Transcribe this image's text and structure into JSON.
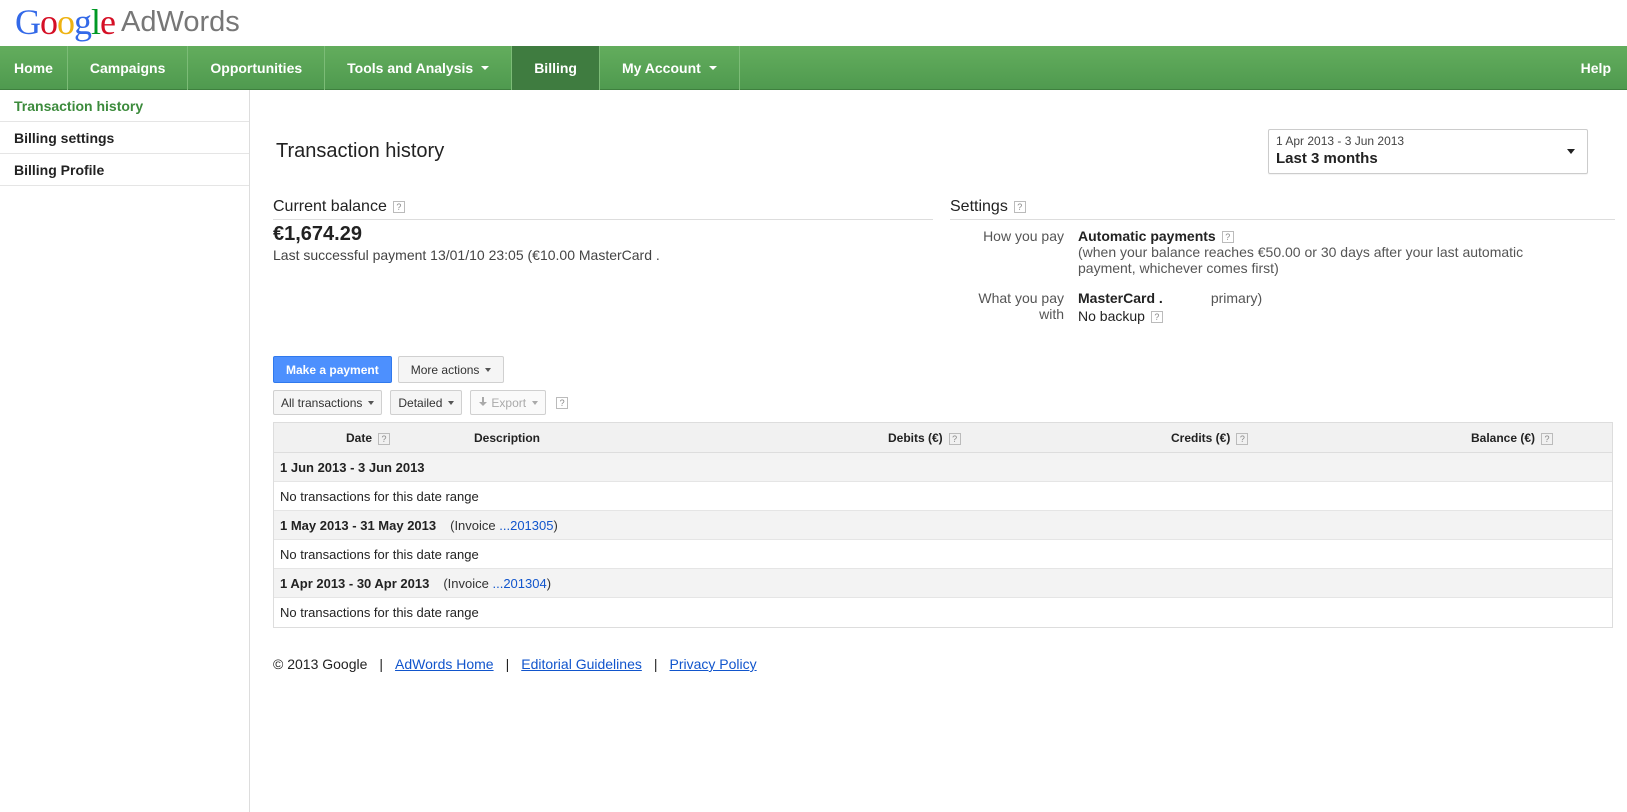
{
  "brand": {
    "google": "Google",
    "product": "AdWords"
  },
  "nav": {
    "tabs": [
      {
        "label": "Home"
      },
      {
        "label": "Campaigns"
      },
      {
        "label": "Opportunities"
      },
      {
        "label": "Tools and Analysis"
      },
      {
        "label": "Billing"
      },
      {
        "label": "My Account"
      }
    ],
    "help": "Help",
    "active": "Billing"
  },
  "sidebar": {
    "items": [
      {
        "label": "Transaction history"
      },
      {
        "label": "Billing settings"
      },
      {
        "label": "Billing Profile"
      }
    ]
  },
  "page": {
    "title": "Transaction history",
    "date_range": {
      "range": "1 Apr 2013 - 3 Jun 2013",
      "label": "Last 3 months"
    }
  },
  "balance": {
    "heading": "Current balance",
    "amount": "€1,674.29",
    "last_payment": "Last successful payment 13/01/10 23:05 (€10.00 MasterCard ."
  },
  "settings": {
    "heading": "Settings",
    "how_label": "How you pay",
    "how_value": "Automatic payments",
    "how_note": "(when your balance reaches €50.00 or 30 days after your last automatic payment, whichever comes first)",
    "with_label": "What you pay with",
    "with_card": "MasterCard .",
    "with_primary": "primary)",
    "backup": "No backup"
  },
  "actions": {
    "make_payment": "Make a payment",
    "more_actions": "More actions",
    "all_transactions": "All transactions",
    "detailed": "Detailed",
    "export": "Export",
    "help_mark": "?"
  },
  "table": {
    "columns": {
      "date": "Date",
      "description": "Description",
      "debits": "Debits (€)",
      "credits": "Credits (€)",
      "balance": "Balance (€)"
    },
    "periods": [
      {
        "range": "1 Jun 2013 - 3 Jun 2013",
        "invoice_prefix": "",
        "invoice": "",
        "invoice_suffix": "",
        "message": "No transactions for this date range"
      },
      {
        "range": "1 May 2013 - 31 May 2013",
        "invoice_prefix": "(Invoice ",
        "invoice": "...201305",
        "invoice_suffix": ")",
        "message": "No transactions for this date range"
      },
      {
        "range": "1 Apr 2013 - 30 Apr 2013",
        "invoice_prefix": "(Invoice ",
        "invoice": "...201304",
        "invoice_suffix": ")",
        "message": "No transactions for this date range"
      }
    ]
  },
  "footer": {
    "copyright": "© 2013 Google",
    "sep": "|",
    "links": [
      "AdWords Home",
      "Editorial Guidelines",
      "Privacy Policy"
    ]
  },
  "colors": {
    "nav_green": "#5aa55a",
    "nav_active": "#3f7c40",
    "sidebar_active": "#3c8b3c",
    "button_blue": "#4d90fe",
    "link_blue": "#1155cc"
  }
}
